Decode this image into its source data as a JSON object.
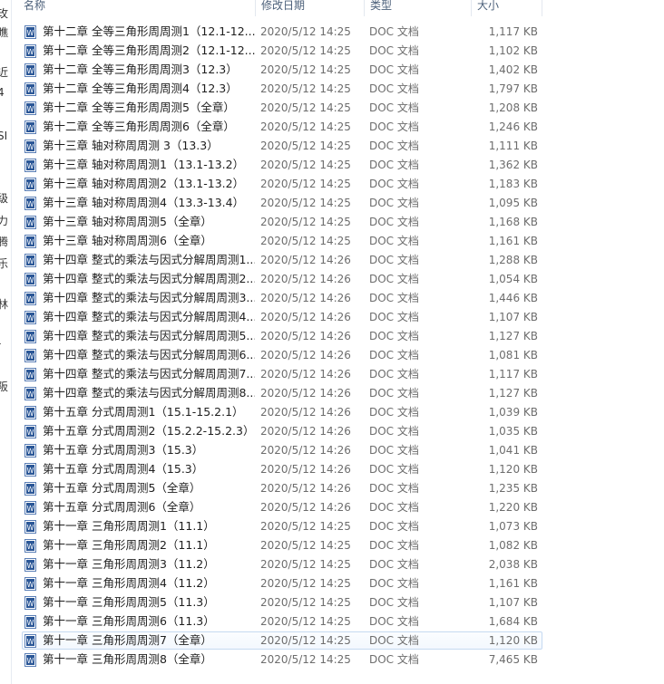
{
  "columns": {
    "name": "名称",
    "date": "修改日期",
    "type": "类型",
    "size": "大小"
  },
  "nav_fragments": [
    "玫",
    "瞧",
    "近",
    "4",
    "SI",
    "级",
    "力",
    "腾",
    "乐",
    "林",
    "-",
    "阪"
  ],
  "icon": "word-document-icon",
  "selected_index": 32,
  "files": [
    {
      "name": "第十二章 全等三角形周周测1（12.1-12....",
      "date": "2020/5/12 14:25",
      "type": "DOC 文档",
      "size": "1,117 KB"
    },
    {
      "name": "第十二章 全等三角形周周测2（12.1-12....",
      "date": "2020/5/12 14:25",
      "type": "DOC 文档",
      "size": "1,102 KB"
    },
    {
      "name": "第十二章 全等三角形周周测3（12.3）",
      "date": "2020/5/12 14:25",
      "type": "DOC 文档",
      "size": "1,402 KB"
    },
    {
      "name": "第十二章 全等三角形周周测4（12.3）",
      "date": "2020/5/12 14:25",
      "type": "DOC 文档",
      "size": "1,797 KB"
    },
    {
      "name": "第十二章 全等三角形周周测5（全章）",
      "date": "2020/5/12 14:25",
      "type": "DOC 文档",
      "size": "1,208 KB"
    },
    {
      "name": "第十二章 全等三角形周周测6（全章）",
      "date": "2020/5/12 14:25",
      "type": "DOC 文档",
      "size": "1,246 KB"
    },
    {
      "name": "第十三章 轴对称周周测 3（13.3）",
      "date": "2020/5/12 14:25",
      "type": "DOC 文档",
      "size": "1,111 KB"
    },
    {
      "name": "第十三章 轴对称周周测1（13.1-13.2）",
      "date": "2020/5/12 14:25",
      "type": "DOC 文档",
      "size": "1,362 KB"
    },
    {
      "name": "第十三章 轴对称周周测2（13.1-13.2）",
      "date": "2020/5/12 14:25",
      "type": "DOC 文档",
      "size": "1,183 KB"
    },
    {
      "name": "第十三章 轴对称周周测4（13.3-13.4）",
      "date": "2020/5/12 14:25",
      "type": "DOC 文档",
      "size": "1,095 KB"
    },
    {
      "name": "第十三章 轴对称周周测5（全章）",
      "date": "2020/5/12 14:25",
      "type": "DOC 文档",
      "size": "1,168 KB"
    },
    {
      "name": "第十三章 轴对称周周测6（全章）",
      "date": "2020/5/12 14:25",
      "type": "DOC 文档",
      "size": "1,161 KB"
    },
    {
      "name": "第十四章 整式的乘法与因式分解周周测1...",
      "date": "2020/5/12 14:26",
      "type": "DOC 文档",
      "size": "1,288 KB"
    },
    {
      "name": "第十四章 整式的乘法与因式分解周周测2...",
      "date": "2020/5/12 14:26",
      "type": "DOC 文档",
      "size": "1,054 KB"
    },
    {
      "name": "第十四章 整式的乘法与因式分解周周测3...",
      "date": "2020/5/12 14:26",
      "type": "DOC 文档",
      "size": "1,446 KB"
    },
    {
      "name": "第十四章 整式的乘法与因式分解周周测4...",
      "date": "2020/5/12 14:26",
      "type": "DOC 文档",
      "size": "1,107 KB"
    },
    {
      "name": "第十四章 整式的乘法与因式分解周周测5...",
      "date": "2020/5/12 14:26",
      "type": "DOC 文档",
      "size": "1,127 KB"
    },
    {
      "name": "第十四章 整式的乘法与因式分解周周测6...",
      "date": "2020/5/12 14:26",
      "type": "DOC 文档",
      "size": "1,081 KB"
    },
    {
      "name": "第十四章 整式的乘法与因式分解周周测7...",
      "date": "2020/5/12 14:26",
      "type": "DOC 文档",
      "size": "1,117 KB"
    },
    {
      "name": "第十四章 整式的乘法与因式分解周周测8...",
      "date": "2020/5/12 14:26",
      "type": "DOC 文档",
      "size": "1,127 KB"
    },
    {
      "name": "第十五章 分式周周测1（15.1-15.2.1）",
      "date": "2020/5/12 14:26",
      "type": "DOC 文档",
      "size": "1,039 KB"
    },
    {
      "name": "第十五章 分式周周测2（15.2.2-15.2.3）",
      "date": "2020/5/12 14:26",
      "type": "DOC 文档",
      "size": "1,035 KB"
    },
    {
      "name": "第十五章 分式周周测3（15.3）",
      "date": "2020/5/12 14:26",
      "type": "DOC 文档",
      "size": "1,041 KB"
    },
    {
      "name": "第十五章 分式周周测4（15.3）",
      "date": "2020/5/12 14:26",
      "type": "DOC 文档",
      "size": "1,120 KB"
    },
    {
      "name": "第十五章 分式周周测5（全章）",
      "date": "2020/5/12 14:26",
      "type": "DOC 文档",
      "size": "1,235 KB"
    },
    {
      "name": "第十五章 分式周周测6（全章）",
      "date": "2020/5/12 14:26",
      "type": "DOC 文档",
      "size": "1,220 KB"
    },
    {
      "name": "第十一章 三角形周周测1（11.1）",
      "date": "2020/5/12 14:25",
      "type": "DOC 文档",
      "size": "1,073 KB"
    },
    {
      "name": "第十一章 三角形周周测2（11.1）",
      "date": "2020/5/12 14:25",
      "type": "DOC 文档",
      "size": "1,082 KB"
    },
    {
      "name": "第十一章 三角形周周测3（11.2）",
      "date": "2020/5/12 14:25",
      "type": "DOC 文档",
      "size": "2,038 KB"
    },
    {
      "name": "第十一章 三角形周周测4（11.2）",
      "date": "2020/5/12 14:25",
      "type": "DOC 文档",
      "size": "1,161 KB"
    },
    {
      "name": "第十一章 三角形周周测5（11.3）",
      "date": "2020/5/12 14:25",
      "type": "DOC 文档",
      "size": "1,107 KB"
    },
    {
      "name": "第十一章 三角形周周测6（11.3）",
      "date": "2020/5/12 14:25",
      "type": "DOC 文档",
      "size": "1,684 KB"
    },
    {
      "name": "第十一章 三角形周周测7（全章）",
      "date": "2020/5/12 14:25",
      "type": "DOC 文档",
      "size": "1,120 KB"
    },
    {
      "name": "第十一章 三角形周周测8（全章）",
      "date": "2020/5/12 14:25",
      "type": "DOC 文档",
      "size": "7,465 KB"
    }
  ]
}
